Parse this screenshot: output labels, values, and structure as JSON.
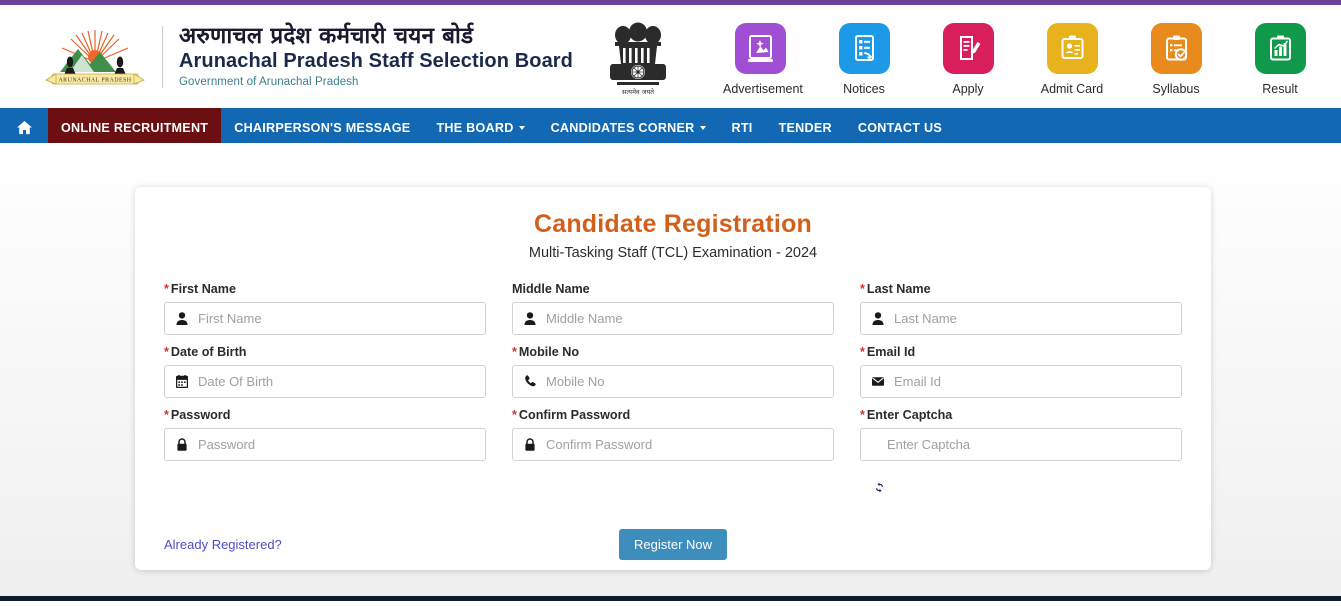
{
  "theme": {
    "top_strip_color": "#6b4099",
    "nav_bg_color": "#1268b3",
    "nav_active_color": "#6b0f12",
    "title_color": "#d2601a",
    "button_color": "#3d8ebd",
    "link_color": "#4a4ec4",
    "bottom_strip_color": "#0e1b2b"
  },
  "header": {
    "logo": {
      "icon": "arunachal-pradesh-state-emblem",
      "caption": "ARUNACHAL PRADESH"
    },
    "title_hindi": "अरुणाचल प्रदेश कर्मचारी चयन बोर्ड",
    "title_english": "Arunachal Pradesh Staff Selection Board",
    "subtitle": "Government of Arunachal Pradesh",
    "emblem": {
      "icon": "india-national-emblem",
      "caption": "सत्यमेव जयते"
    }
  },
  "quicklinks": [
    {
      "label": "Advertisement",
      "icon": "advertisement-icon",
      "color": "#a04fd4"
    },
    {
      "label": "Notices",
      "icon": "notices-icon",
      "color": "#1c9ae8"
    },
    {
      "label": "Apply",
      "icon": "apply-icon",
      "color": "#d81e5b"
    },
    {
      "label": "Admit Card",
      "icon": "admit-card-icon",
      "color": "#e8b21c"
    },
    {
      "label": "Syllabus",
      "icon": "syllabus-icon",
      "color": "#e88a1c"
    },
    {
      "label": "Result",
      "icon": "result-icon",
      "color": "#11994b"
    }
  ],
  "nav": {
    "home_icon": "home-icon",
    "items": [
      {
        "label": "ONLINE RECRUITMENT",
        "active": true,
        "dropdown": false
      },
      {
        "label": "CHAIRPERSON'S MESSAGE",
        "active": false,
        "dropdown": false
      },
      {
        "label": "THE BOARD",
        "active": false,
        "dropdown": true
      },
      {
        "label": "CANDIDATES CORNER",
        "active": false,
        "dropdown": true
      },
      {
        "label": "RTI",
        "active": false,
        "dropdown": false
      },
      {
        "label": "TENDER",
        "active": false,
        "dropdown": false
      },
      {
        "label": "CONTACT US",
        "active": false,
        "dropdown": false
      }
    ]
  },
  "form": {
    "title": "Candidate Registration",
    "subtitle": "Multi-Tasking Staff (TCL) Examination - 2024",
    "fields": [
      {
        "label": "First Name",
        "placeholder": "First Name",
        "required": true,
        "value": "",
        "icon": "user-icon"
      },
      {
        "label": "Middle Name",
        "placeholder": "Middle Name",
        "required": false,
        "value": "",
        "icon": "user-icon"
      },
      {
        "label": "Last Name",
        "placeholder": "Last Name",
        "required": true,
        "value": "",
        "icon": "user-icon"
      },
      {
        "label": "Date of Birth",
        "placeholder": "Date Of Birth",
        "required": true,
        "value": "",
        "icon": "calendar-icon"
      },
      {
        "label": "Mobile No",
        "placeholder": "Mobile No",
        "required": true,
        "value": "",
        "icon": "phone-icon"
      },
      {
        "label": "Email Id",
        "placeholder": "Email Id",
        "required": true,
        "value": "",
        "icon": "envelope-icon"
      },
      {
        "label": "Password",
        "placeholder": "Password",
        "required": true,
        "value": "",
        "icon": "lock-icon"
      },
      {
        "label": "Confirm Password",
        "placeholder": "Confirm Password",
        "required": true,
        "value": "",
        "icon": "lock-icon"
      },
      {
        "label": "Enter Captcha",
        "placeholder": "Enter Captcha",
        "required": true,
        "value": "",
        "icon": "none"
      }
    ],
    "refresh_icon": "refresh-captcha-icon",
    "already_registered_label": "Already Registered?",
    "submit_label": "Register Now"
  }
}
